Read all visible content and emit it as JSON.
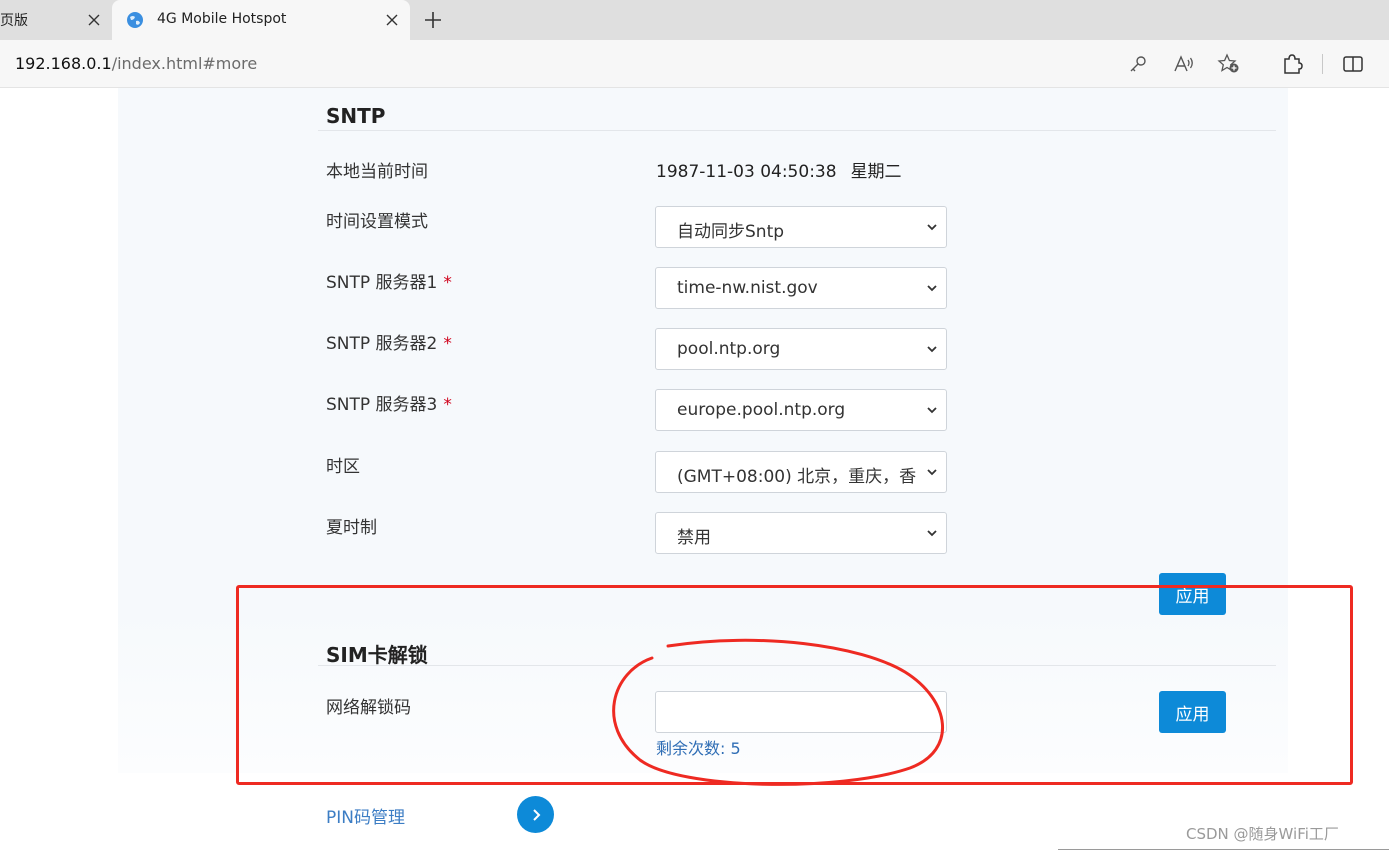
{
  "browser": {
    "tabs": [
      {
        "title": "页版",
        "active": false
      },
      {
        "title": "4G Mobile Hotspot",
        "active": true
      }
    ],
    "url_host": "192.168.0.1",
    "url_path": "/index.html#more",
    "toolbar_icons": [
      "key-icon",
      "read-aloud-icon",
      "add-favorite-icon",
      "extensions-icon",
      "split-screen-icon"
    ]
  },
  "sntp": {
    "title": "SNTP",
    "local_time_label": "本地当前时间",
    "local_time_value": "1987-11-03 04:50:38",
    "weekday": "星期二",
    "mode_label": "时间设置模式",
    "mode_value": "自动同步Sntp",
    "server1_label": "SNTP 服务器1",
    "server1_value": "time-nw.nist.gov",
    "server2_label": "SNTP 服务器2",
    "server2_value": "pool.ntp.org",
    "server3_label": "SNTP 服务器3",
    "server3_value": "europe.pool.ntp.org",
    "required_mark": "*",
    "timezone_label": "时区",
    "timezone_value": "(GMT+08:00) 北京，重庆，香",
    "dst_label": "夏时制",
    "dst_value": "禁用",
    "apply_label": "应用"
  },
  "sim_unlock": {
    "title": "SIM卡解锁",
    "code_label": "网络解锁码",
    "code_value": "",
    "remaining_text": "剩余次数: 5",
    "apply_label": "应用"
  },
  "pin": {
    "link_text": "PIN码管理"
  },
  "watermark": "CSDN @随身WiFi工厂",
  "colors": {
    "accent": "#0d8ad8",
    "annotation": "#ee2a22",
    "link": "#3c7dc4"
  }
}
